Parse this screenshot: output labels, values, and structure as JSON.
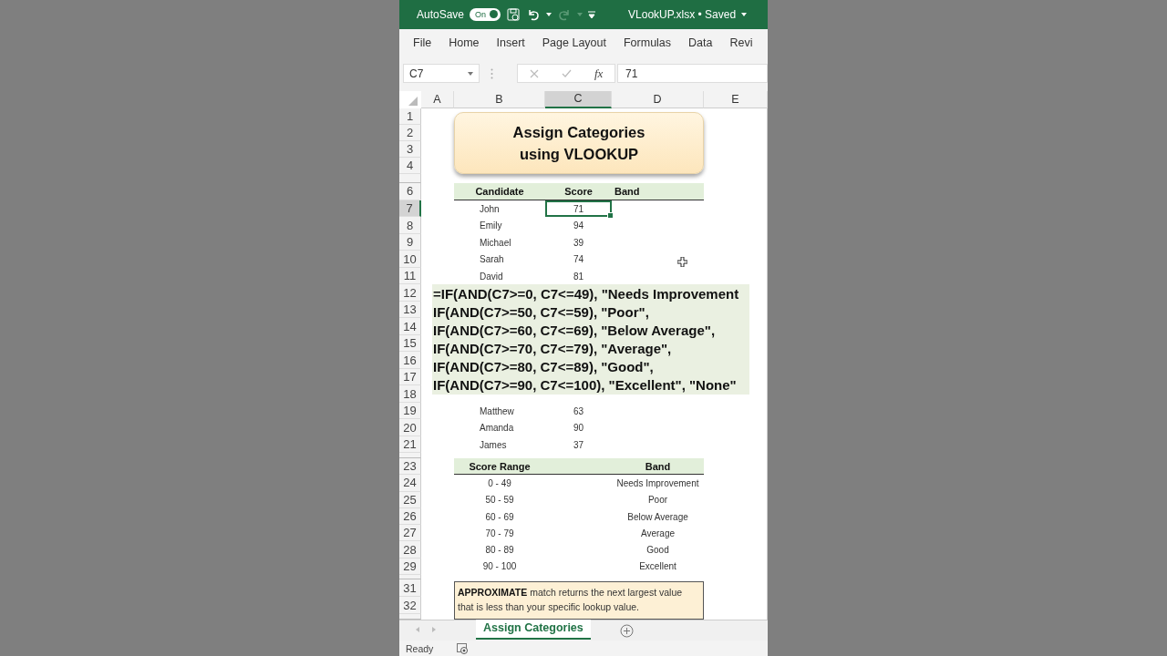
{
  "title_bar": {
    "autosave_label": "AutoSave",
    "autosave_toggle": {
      "label": "On",
      "on": true
    },
    "file_name": "VLookUP.xlsx • Saved"
  },
  "ribbon_tabs": [
    "File",
    "Home",
    "Insert",
    "Page Layout",
    "Formulas",
    "Data",
    "Revi"
  ],
  "formula_bar": {
    "name_box": "C7",
    "function_label": "fx",
    "value": "71"
  },
  "columns": [
    {
      "label": "A",
      "selected": false
    },
    {
      "label": "B",
      "selected": false
    },
    {
      "label": "C",
      "selected": true
    },
    {
      "label": "D",
      "selected": false
    },
    {
      "label": "E",
      "selected": false
    }
  ],
  "row_numbers": [
    {
      "label": "1",
      "selected": false
    },
    {
      "label": "2",
      "selected": false
    },
    {
      "label": "3",
      "selected": false
    },
    {
      "label": "4",
      "selected": false
    },
    {
      "label": "6",
      "selected": false
    },
    {
      "label": "7",
      "selected": true
    },
    {
      "label": "8",
      "selected": false
    },
    {
      "label": "9",
      "selected": false
    },
    {
      "label": "10",
      "selected": false
    },
    {
      "label": "11",
      "selected": false
    },
    {
      "label": "12",
      "selected": false
    },
    {
      "label": "13",
      "selected": false
    },
    {
      "label": "14",
      "selected": false
    },
    {
      "label": "15",
      "selected": false
    },
    {
      "label": "16",
      "selected": false
    },
    {
      "label": "17",
      "selected": false
    },
    {
      "label": "18",
      "selected": false
    },
    {
      "label": "19",
      "selected": false
    },
    {
      "label": "20",
      "selected": false
    },
    {
      "label": "21",
      "selected": false
    },
    {
      "label": "23",
      "selected": false
    },
    {
      "label": "24",
      "selected": false
    },
    {
      "label": "25",
      "selected": false
    },
    {
      "label": "26",
      "selected": false
    },
    {
      "label": "27",
      "selected": false
    },
    {
      "label": "28",
      "selected": false
    },
    {
      "label": "29",
      "selected": false
    },
    {
      "label": "31",
      "selected": false
    },
    {
      "label": "32",
      "selected": false
    }
  ],
  "title_box": [
    "Assign Categories",
    "using VLOOKUP"
  ],
  "candidates_table": {
    "headers": [
      "Candidate",
      "Score",
      "Band"
    ],
    "rows": [
      {
        "name": "John",
        "score": "71",
        "selected": true
      },
      {
        "name": "Emily",
        "score": "94",
        "selected": false
      },
      {
        "name": "Michael",
        "score": "39",
        "selected": false
      },
      {
        "name": "Sarah",
        "score": "74",
        "selected": false
      },
      {
        "name": "David",
        "score": "81",
        "selected": false
      },
      {
        "name": "Matthew",
        "score": "63",
        "selected": false
      },
      {
        "name": "Amanda",
        "score": "90",
        "selected": false
      },
      {
        "name": "James",
        "score": "37",
        "selected": false
      }
    ]
  },
  "formula_overlay": [
    "=IF(AND(C7>=0, C7<=49), \"Needs Improvement",
    "IF(AND(C7>=50, C7<=59), \"Poor\",",
    "IF(AND(C7>=60, C7<=69), \"Below Average\",",
    "IF(AND(C7>=70, C7<=79), \"Average\",",
    "IF(AND(C7>=80, C7<=89), \"Good\",",
    "IF(AND(C7>=90, C7<=100), \"Excellent\", \"None\""
  ],
  "bands_table": {
    "headers": [
      "Score Range",
      "Band"
    ],
    "rows": [
      {
        "range": "0 - 49",
        "band": "Needs Improvement"
      },
      {
        "range": "50 - 59",
        "band": "Poor"
      },
      {
        "range": "60 - 69",
        "band": "Below Average"
      },
      {
        "range": "70 - 79",
        "band": "Average"
      },
      {
        "range": "80 - 89",
        "band": "Good"
      },
      {
        "range": "90 - 100",
        "band": "Excellent"
      }
    ]
  },
  "note": "**APPROXIMATE** match returns the next largest value that is less than your specific lookup value.",
  "sheet_tabs": [
    {
      "label": "Assign Categories",
      "selected": true
    }
  ],
  "status_bar": {
    "text": "Ready"
  }
}
